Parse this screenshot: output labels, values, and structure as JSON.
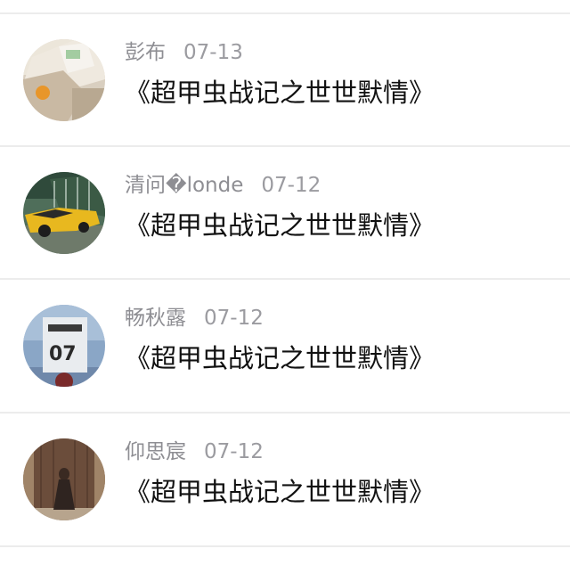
{
  "comments": [
    {
      "author": "彭布",
      "date": "07-13",
      "text": "《超甲虫战记之世世默情》",
      "avatar": "food-photo"
    },
    {
      "author": "清问�londe",
      "date": "07-12",
      "text": "《超甲虫战记之世世默情》",
      "avatar": "yellow-car-photo"
    },
    {
      "author": "畅秋露",
      "date": "07-12",
      "text": "《超甲虫战记之世世默情》",
      "avatar": "jersey-07-photo",
      "avatar_text": "07"
    },
    {
      "author": "仰思宸",
      "date": "07-12",
      "text": "《超甲虫战记之世世默情》",
      "avatar": "silhouette-door-photo"
    }
  ]
}
